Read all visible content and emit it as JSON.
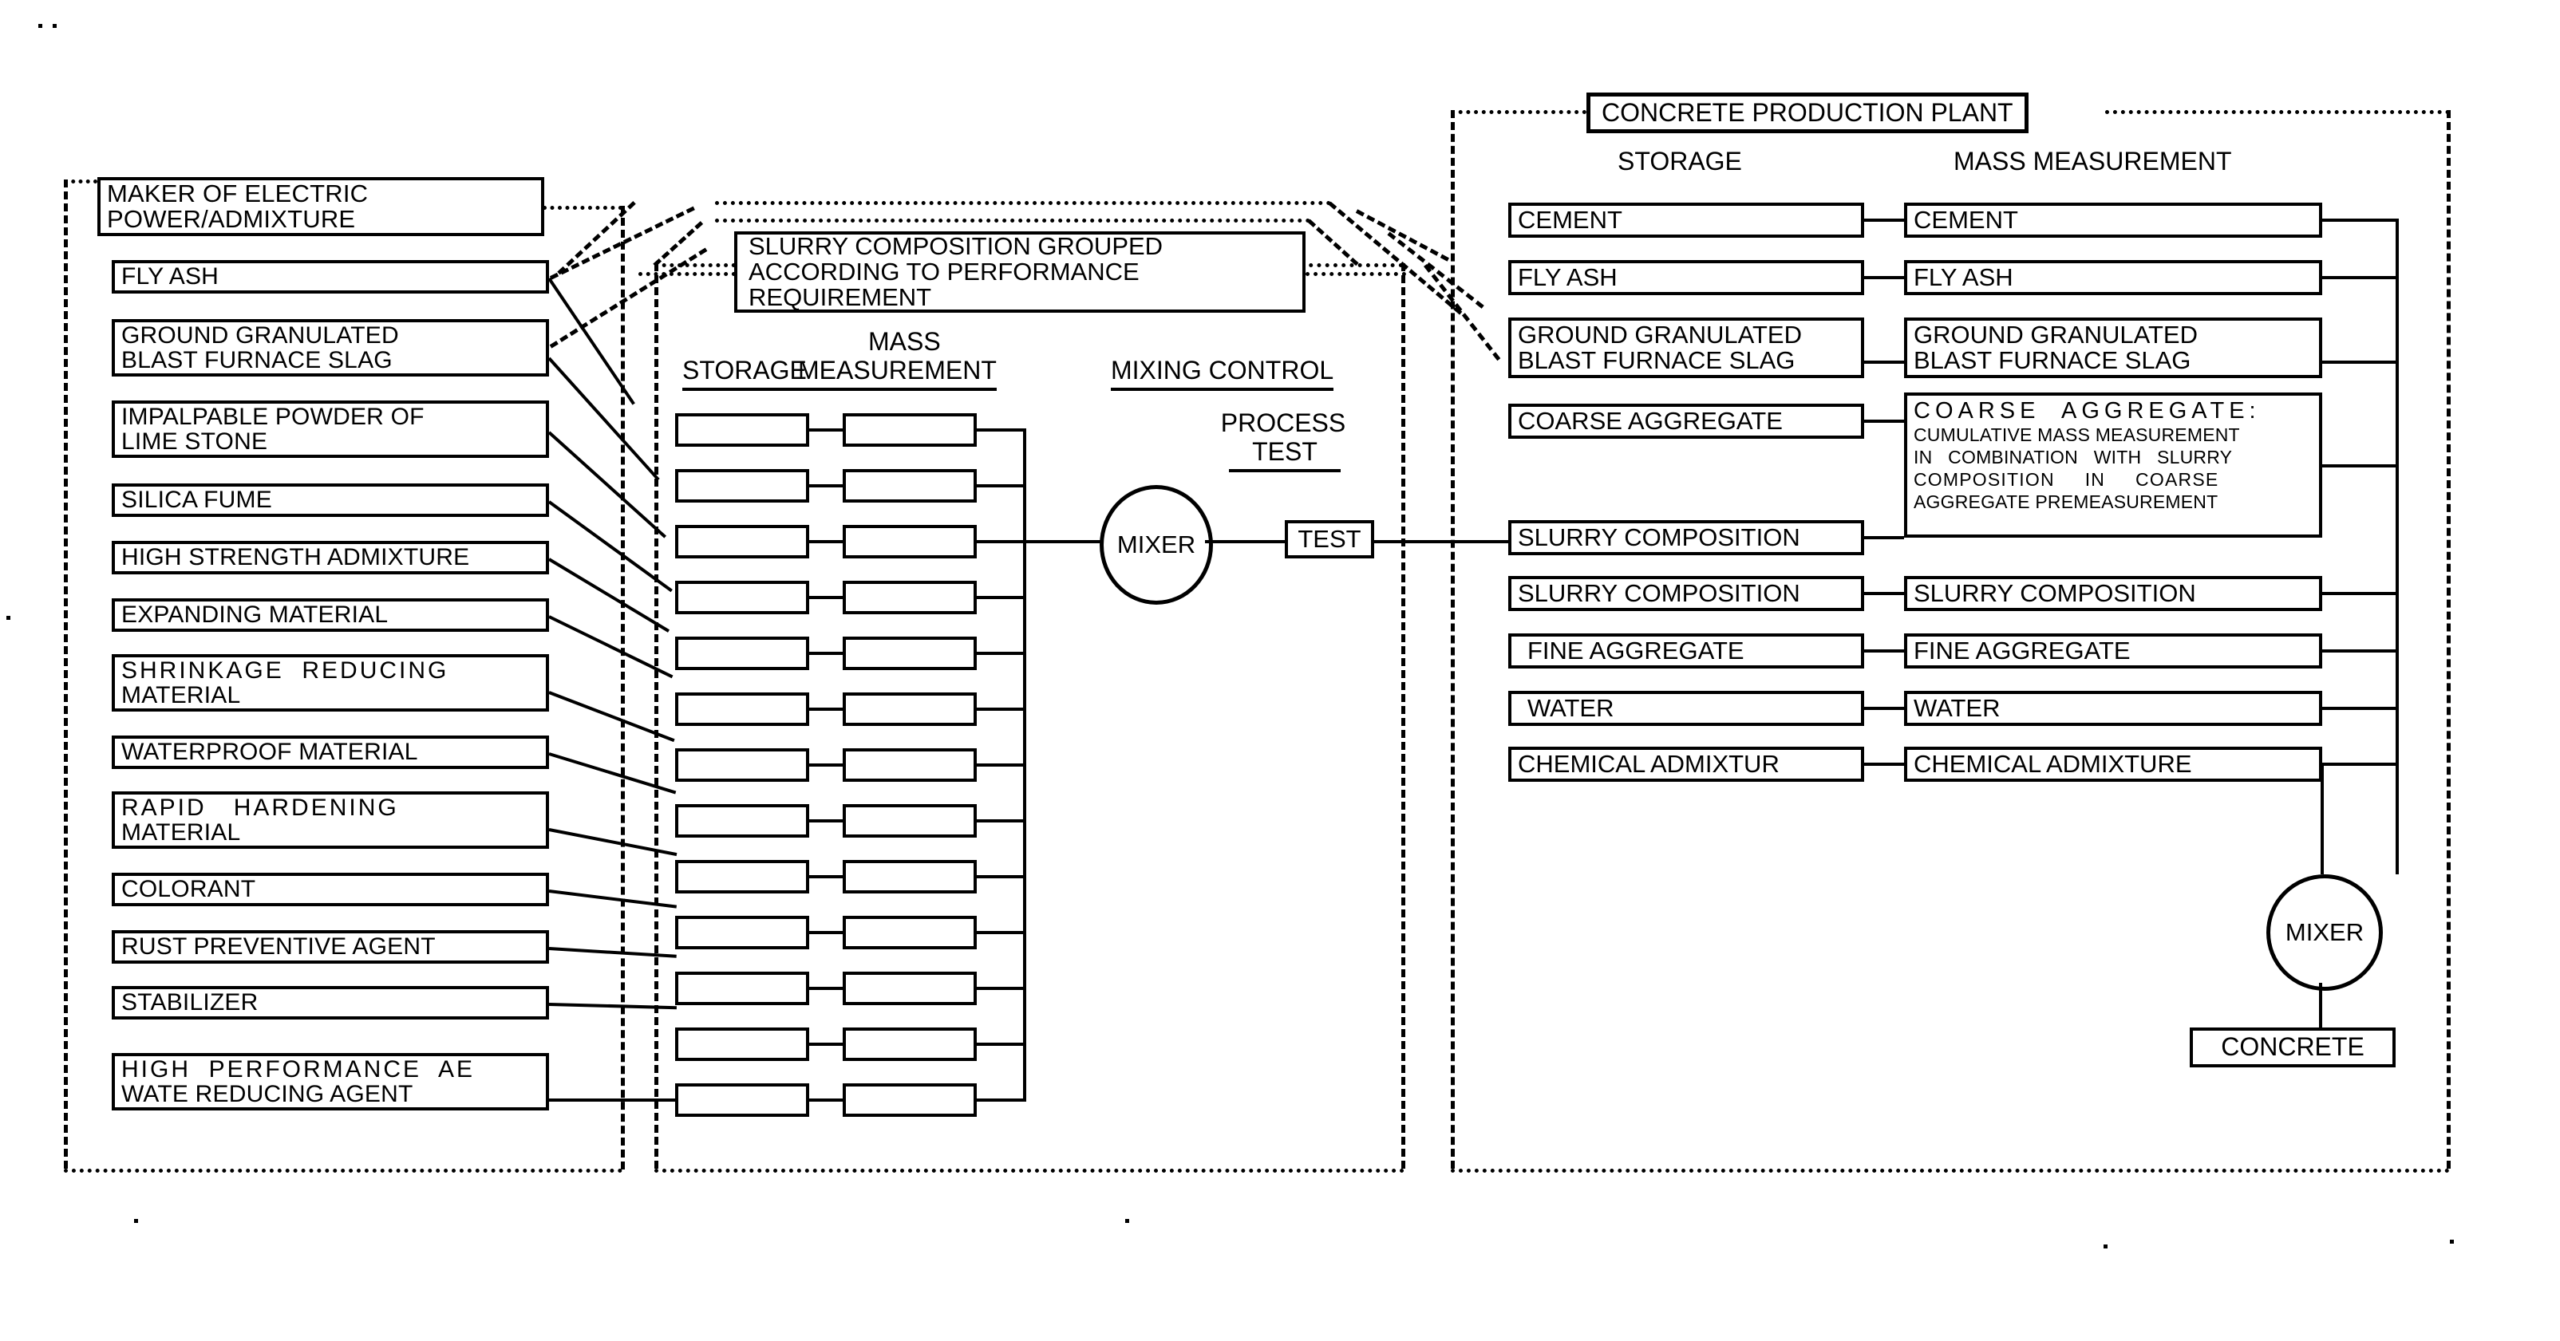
{
  "figure": {
    "type": "patent-flow-diagram",
    "stroke_color": "#000000",
    "background_color": "#ffffff"
  },
  "left_region": {
    "header": {
      "line1": "MAKER OF ELECTRIC",
      "line2": "POWER/ADMIXTURE"
    },
    "materials": [
      {
        "line1": "FLY ASH",
        "line2": ""
      },
      {
        "line1": "GROUND GRANULATED",
        "line2": "BLAST FURNACE SLAG"
      },
      {
        "line1": "IMPALPABLE POWDER OF",
        "line2": "LIME STONE"
      },
      {
        "line1": "SILICA FUME",
        "line2": ""
      },
      {
        "line1": "HIGH STRENGTH ADMIXTURE",
        "line2": ""
      },
      {
        "line1": "EXPANDING MATERIAL",
        "line2": ""
      },
      {
        "line1": "SHRINKAGE  REDUCING",
        "line2": "MATERIAL"
      },
      {
        "line1": "WATERPROOF MATERIAL",
        "line2": ""
      },
      {
        "line1": "RAPID   HARDENING",
        "line2": "MATERIAL"
      },
      {
        "line1": "COLORANT",
        "line2": ""
      },
      {
        "line1": "RUST PREVENTIVE AGENT",
        "line2": ""
      },
      {
        "line1": "STABILIZER",
        "line2": ""
      },
      {
        "line1": "HIGH  PERFORMANCE  AE",
        "line2": "WATE REDUCING AGENT"
      }
    ]
  },
  "center_region": {
    "title": {
      "line1": "SLURRY COMPOSITION GROUPED",
      "line2": "ACCORDING TO PERFORMANCE",
      "line3": "REQUIREMENT"
    },
    "column_headers": {
      "storage": "STORAGE",
      "mass_measurement_line1": "MASS",
      "mass_measurement_line2": "MEASUREMENT",
      "mixing_control": "MIXING CONTROL"
    },
    "process_test": {
      "line1": "PROCESS",
      "line2": "TEST"
    },
    "mixer_label": "MIXER",
    "test_label": "TEST",
    "row_count": 13,
    "rows": [
      {
        "storage": "",
        "measurement": ""
      },
      {
        "storage": "",
        "measurement": ""
      },
      {
        "storage": "",
        "measurement": ""
      },
      {
        "storage": "",
        "measurement": ""
      },
      {
        "storage": "",
        "measurement": ""
      },
      {
        "storage": "",
        "measurement": ""
      },
      {
        "storage": "",
        "measurement": ""
      },
      {
        "storage": "",
        "measurement": ""
      },
      {
        "storage": "",
        "measurement": ""
      },
      {
        "storage": "",
        "measurement": ""
      },
      {
        "storage": "",
        "measurement": ""
      },
      {
        "storage": "",
        "measurement": ""
      },
      {
        "storage": "",
        "measurement": ""
      }
    ]
  },
  "right_region": {
    "plant_title": "CONCRETE PRODUCTION PLANT",
    "column_headers": {
      "storage": "STORAGE",
      "mass_measurement": "MASS MEASUREMENT"
    },
    "rows": [
      {
        "storage_line1": "CEMENT",
        "storage_line2": "",
        "measurement_line1": "CEMENT",
        "measurement_line2": ""
      },
      {
        "storage_line1": "FLY ASH",
        "storage_line2": "",
        "measurement_line1": "FLY ASH",
        "measurement_line2": ""
      },
      {
        "storage_line1": "GROUND GRANULATED",
        "storage_line2": "BLAST FURNACE SLAG",
        "measurement_line1": "GROUND GRANULATED",
        "measurement_line2": "BLAST FURNACE SLAG"
      },
      {
        "storage_line1": "COARSE AGGREGATE",
        "storage_line2": "",
        "measurement_line1": "COARSE  AGGREGATE:",
        "measurement_line2": ""
      },
      {
        "storage_line1": "SLURRY COMPOSITION",
        "storage_line2": "",
        "measurement_line1": "",
        "measurement_line2": ""
      },
      {
        "storage_line1": "SLURRY COMPOSITION",
        "storage_line2": "",
        "measurement_line1": "SLURRY COMPOSITION",
        "measurement_line2": ""
      },
      {
        "storage_line1": "FINE AGGREGATE",
        "storage_line2": "",
        "measurement_line1": "FINE AGGREGATE",
        "measurement_line2": ""
      },
      {
        "storage_line1": "WATER",
        "storage_line2": "",
        "measurement_line1": "WATER",
        "measurement_line2": ""
      },
      {
        "storage_line1": "CHEMICAL ADMIXTUR",
        "storage_line2": "",
        "measurement_line1": "CHEMICAL ADMIXTURE",
        "measurement_line2": ""
      }
    ],
    "coarse_aggregate_detail": {
      "heading": "COARSE  AGGREGATE:",
      "body_line1": "CUMULATIVE MASS MEASUREMENT",
      "body_line2": "IN   COMBINATION   WITH   SLURRY",
      "body_line3": "COMPOSITION     IN     COARSE",
      "body_line4": "AGGREGATE PREMEASUREMENT"
    },
    "mixer_label": "MIXER",
    "output_label": "CONCRETE"
  }
}
